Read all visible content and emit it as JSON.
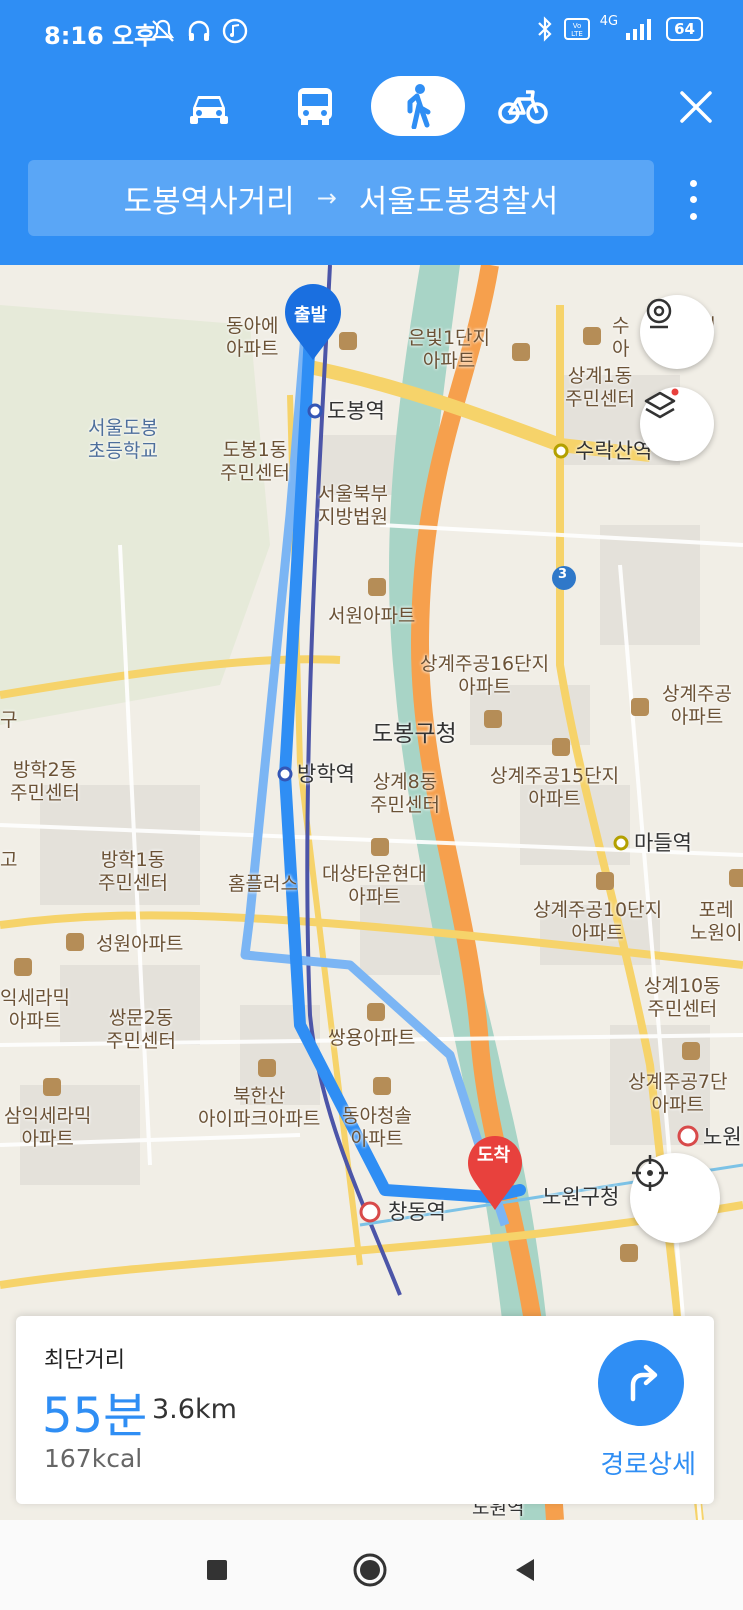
{
  "status": {
    "time": "8:16 오후",
    "network": "4G",
    "battery": "64"
  },
  "modes": [
    {
      "name": "car",
      "icon": "car-icon"
    },
    {
      "name": "bus",
      "icon": "bus-icon"
    },
    {
      "name": "walk",
      "icon": "walk-icon",
      "active": true
    },
    {
      "name": "bike",
      "icon": "bike-icon"
    }
  ],
  "route": {
    "origin": "도봉역사거리",
    "arrow": "→",
    "destination": "서울도봉경찰서"
  },
  "map": {
    "start_marker": "출발",
    "end_marker": "도착",
    "labels": {
      "dongah_apt": "동아에\n아파트",
      "eunbit_apt": "은빛1단지\n아파트",
      "sugye_apt": "수\n아",
      "sangye1_center": "상계1동\n주민센터",
      "dobong_station": "도봉역",
      "suraksan_station": "수락산역",
      "dobong_elem": "서울도봉\n초등학교",
      "dobong1_center": "도봉1동\n주민센터",
      "court": "서울북부\n지방법원",
      "seowon_apt": "서원아파트",
      "sanggye16": "상계주공16단지\n아파트",
      "sanggye_right": "상계주공\n아파트",
      "dobong_gu_office": "도봉구청",
      "banghak2_center": "방학2동\n주민센터",
      "banghak_station": "방학역",
      "sanggye8_center": "상계8동\n주민센터",
      "sanggye15": "상계주공15단지\n아파트",
      "madeul_station": "마들역",
      "banghak1_center": "방학1동\n주민센터",
      "homeplus": "홈플러스",
      "daesang_apt": "대상타운현대\n아파트",
      "sanggye10": "상계주공10단지\n아파트",
      "poreo": "포레\n노원이",
      "seongwon_apt": "성원아파트",
      "samik_apt1": "익세라믹\n아파트",
      "ssangmun2_center": "쌍문2동\n주민센터",
      "ssangyong_apt": "쌍용아파트",
      "sanggye10_center": "상계10동\n주민센터",
      "bukhansan_apt": "북한산\n아이파크아파트",
      "dongah_cheongsol": "동아청솔\n아파트",
      "sanggye7": "상계주공7단\n아파트",
      "samik_apt2": "삼익세라믹\n아파트",
      "changdong_station": "창동역",
      "nowon_gu_office": "노원구청",
      "nowon_station": "노원",
      "nocheon_station": "노원역",
      "route_num": "3",
      "left_edge_1": "구",
      "left_edge_2": "고",
      "right_edge_1": "체"
    }
  },
  "summary": {
    "route_type": "최단거리",
    "duration": "55분",
    "distance": "3.6km",
    "calories": "167kcal",
    "detail_label": "경로상세"
  }
}
